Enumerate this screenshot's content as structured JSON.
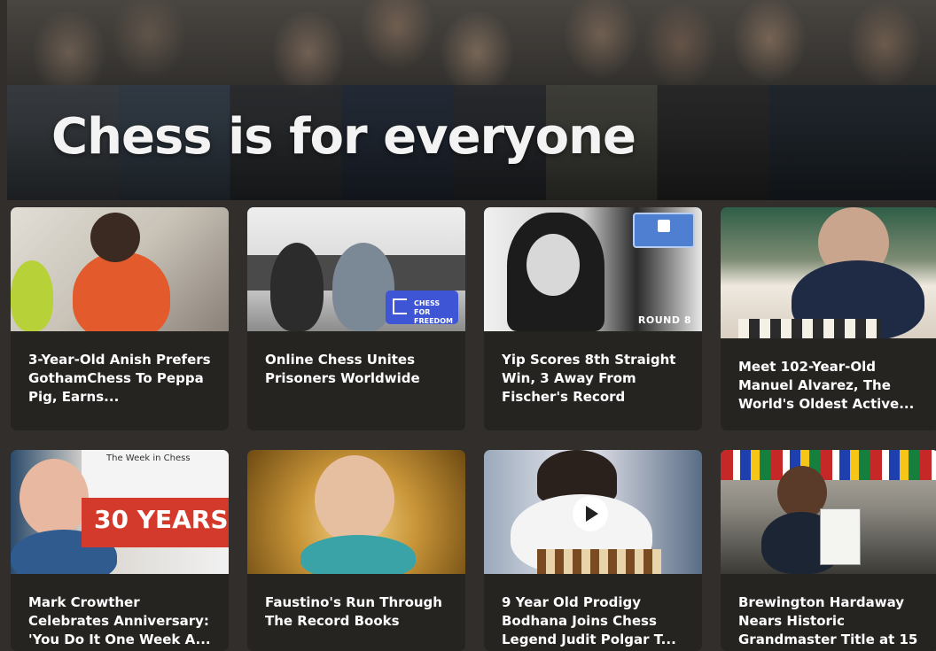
{
  "hero": {
    "title": "Chess is for everyone"
  },
  "articles": [
    {
      "title": "3-Year-Old Anish Prefers GothamChess To Peppa Pig, Earns..."
    },
    {
      "title": "Online Chess Unites Prisoners Worldwide",
      "badge": "CHESS FOR FREEDOM"
    },
    {
      "title": "Yip Scores 8th Straight Win, 3 Away From Fischer's Record",
      "badge": "ROUND 8"
    },
    {
      "title": "Meet 102-Year-Old Manuel Alvarez, The World's Oldest Active..."
    },
    {
      "title": "Mark Crowther Celebrates Anniversary: 'You Do It One Week A...",
      "badge": "30 YEARS",
      "header": "The Week in Chess"
    },
    {
      "title": "Faustino's Run Through The Record Books"
    },
    {
      "title": "9 Year Old Prodigy Bodhana Joins Chess Legend Judit Polgar T..."
    },
    {
      "title": "Brewington Hardaway Nears Historic Grandmaster Title at 15"
    }
  ]
}
